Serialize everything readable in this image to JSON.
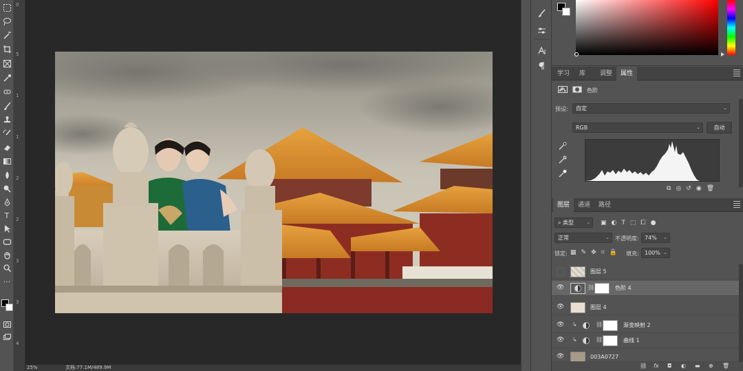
{
  "status": {
    "zoom": "25%",
    "doc_info": "文档:77.1M/489.9M"
  },
  "ruler": {
    "ticks": [
      "0",
      "5",
      "1",
      "1",
      "2",
      "2",
      "3",
      "3",
      "4"
    ]
  },
  "dock": {
    "items": [
      "brush-settings-icon",
      "adjustments-icon",
      "character-icon",
      "paragraph-icon"
    ]
  },
  "top_tabs": {
    "tabs": [
      "学习",
      "库",
      "调整",
      "属性"
    ],
    "active": "属性"
  },
  "properties": {
    "title": "色阶",
    "preset_label": "预设:",
    "preset_value": "自定",
    "channel_value": "RGB",
    "auto_button": "自动"
  },
  "layers_panel": {
    "tabs": [
      "图层",
      "通道",
      "路径"
    ],
    "active": "图层",
    "filter_kind": "类型",
    "blend_mode": "正常",
    "opacity_label": "不透明度:",
    "opacity_value": "74%",
    "lock_label": "锁定:",
    "fill_label": "填充:",
    "fill_value": "100%",
    "layers": [
      {
        "name": "图层 5",
        "visible": false
      },
      {
        "name": "色阶 4",
        "visible": true,
        "selected": true
      },
      {
        "name": "图层 4",
        "visible": true
      },
      {
        "name": "渐变映射 2",
        "visible": true
      },
      {
        "name": "曲线 1",
        "visible": true
      },
      {
        "name": "003A0727",
        "visible": true
      }
    ],
    "footer_fx": "fx"
  },
  "colors": {
    "foreground": "#000000",
    "background": "#ffffff",
    "workspace": "#282828",
    "panel": "#535353"
  }
}
